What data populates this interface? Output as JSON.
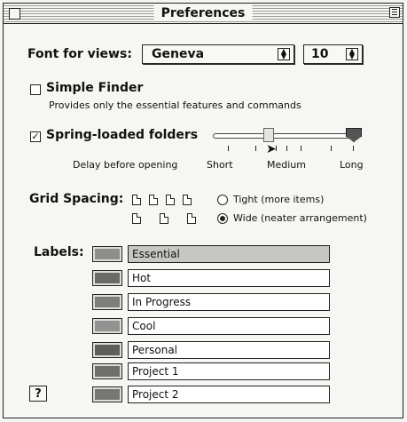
{
  "window": {
    "title": "Preferences"
  },
  "font": {
    "label": "Font for views:",
    "family": "Geneva",
    "size": "10"
  },
  "simple_finder": {
    "label": "Simple Finder",
    "checked": false,
    "description": "Provides only the essential features and commands"
  },
  "spring_loaded": {
    "label": "Spring-loaded folders",
    "checked": true,
    "check_glyph": "✓",
    "delay_label": "Delay before opening",
    "short": "Short",
    "medium": "Medium",
    "long": "Long",
    "level": 0.4
  },
  "grid": {
    "label": "Grid Spacing:",
    "tight": "Tight (more items)",
    "wide": "Wide (neater arrangement)",
    "selected": "wide"
  },
  "labels": {
    "title": "Labels:",
    "items": [
      {
        "name": "Essential",
        "color": "#8e8e8a"
      },
      {
        "name": "Hot",
        "color": "#6b6b68"
      },
      {
        "name": "In Progress",
        "color": "#7d7d79"
      },
      {
        "name": "Cool",
        "color": "#929290"
      },
      {
        "name": "Personal",
        "color": "#5e5e5b"
      },
      {
        "name": "Project 1",
        "color": "#6e6e6b"
      },
      {
        "name": "Project 2",
        "color": "#767673"
      }
    ]
  },
  "help": {
    "glyph": "?"
  }
}
